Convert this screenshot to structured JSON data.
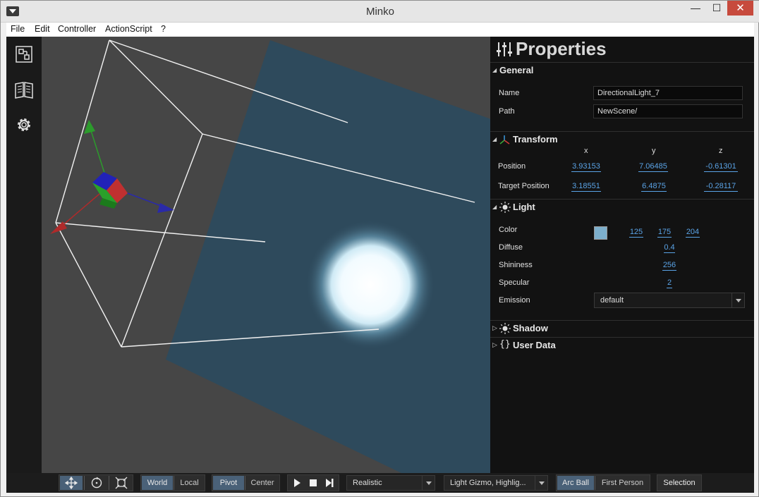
{
  "window": {
    "title": "Minko",
    "min_glyph": "—",
    "max_glyph": "☐",
    "close_glyph": "✕"
  },
  "menu": [
    "File",
    "Edit",
    "Controller",
    "ActionScript",
    "?"
  ],
  "sidebar": [
    "scene-tree-icon",
    "library-icon",
    "settings-icon"
  ],
  "properties": {
    "title": "Properties",
    "general": {
      "label": "General",
      "name_label": "Name",
      "name_value": "DirectionalLight_7",
      "path_label": "Path",
      "path_value": "NewScene/"
    },
    "transform": {
      "label": "Transform",
      "x": "x",
      "y": "y",
      "z": "z",
      "position_label": "Position",
      "position": [
        "3.93153",
        "7.06485",
        "-0.61301"
      ],
      "target_label": "Target Position",
      "target": [
        "3.18551",
        "6.4875",
        "-0.28117"
      ]
    },
    "light": {
      "label": "Light",
      "color_label": "Color",
      "color_hex": "#7dafcc",
      "color": [
        "125",
        "175",
        "204"
      ],
      "diffuse_label": "Diffuse",
      "diffuse": "0.4",
      "shininess_label": "Shininess",
      "shininess": "256",
      "specular_label": "Specular",
      "specular": "2",
      "emission_label": "Emission",
      "emission": "default"
    },
    "shadow": {
      "label": "Shadow"
    },
    "userdata": {
      "label": "User Data"
    }
  },
  "toolbar": {
    "world": "World",
    "local": "Local",
    "pivot": "Pivot",
    "center": "Center",
    "render_mode": "Realistic",
    "gizmo_mode": "Light Gizmo, Highlig...",
    "arcball": "Arc Ball",
    "first_person": "First Person",
    "selection": "Selection"
  }
}
